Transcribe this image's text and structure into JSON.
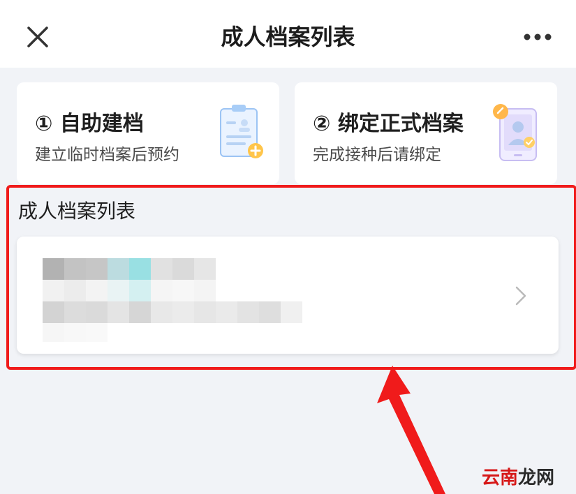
{
  "nav": {
    "title": "成人档案列表",
    "close_icon": "close-icon",
    "more_icon": "more-icon"
  },
  "cards": [
    {
      "title": "① 自助建档",
      "subtitle": "建立临时档案后预约",
      "icon": "clipboard-add-icon"
    },
    {
      "title": "② 绑定正式档案",
      "subtitle": "完成接种后请绑定",
      "icon": "phone-profile-link-icon"
    }
  ],
  "section": {
    "title": "成人档案列表"
  },
  "record": {
    "chevron_icon": "chevron-right-icon"
  },
  "annotation": {
    "highlight_color": "#f01b1b",
    "arrow_color": "#f01b1b"
  },
  "watermark": {
    "part1": "云南",
    "part2": "龙网"
  }
}
